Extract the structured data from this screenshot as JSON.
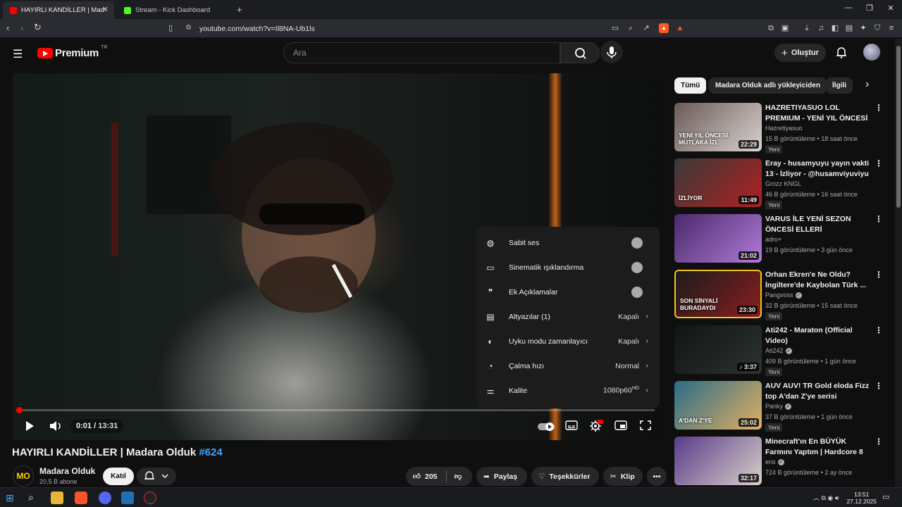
{
  "browser": {
    "tabs": [
      {
        "title": "HAYIRLI KANDİLLER | Madara Ol",
        "favicon_color": "#ff0000"
      },
      {
        "title": "Stream - Kick Dashboard",
        "favicon_color": "#53fc18"
      }
    ],
    "url": "youtube.com/watch?v=Il8NA-Ub1ls",
    "new_tab_symbol": "+"
  },
  "header": {
    "logo_text": "Premium",
    "logo_region": "TR",
    "search_placeholder": "Ara",
    "create_label": "Oluştur"
  },
  "player": {
    "current_time": "0:01",
    "duration": "13:31",
    "progress_fraction": 0.0012,
    "settings": [
      {
        "label": "Sabit ses",
        "type": "toggle",
        "icon": "stable-volume-icon"
      },
      {
        "label": "Sinematik ışıklandırma",
        "type": "toggle",
        "icon": "ambient-mode-icon"
      },
      {
        "label": "Ek Açıklamalar",
        "type": "toggle",
        "icon": "annotations-icon"
      },
      {
        "label": "Altyazılar (1)",
        "type": "value",
        "value": "Kapalı",
        "icon": "subtitles-icon"
      },
      {
        "label": "Uyku modu zamanlayıcı",
        "type": "value",
        "value": "Kapalı",
        "icon": "sleep-timer-icon"
      },
      {
        "label": "Çalma hızı",
        "type": "value",
        "value": "Normal",
        "icon": "playback-speed-icon"
      },
      {
        "label": "Kalite",
        "type": "value",
        "value": "1080p60",
        "value_sup": "HD",
        "icon": "quality-icon"
      }
    ]
  },
  "video": {
    "title": "HAYIRLI KANDİLLER | Madara Olduk",
    "hashtag": "#624",
    "channel_name": "Madara Olduk",
    "channel_logo": "MO",
    "subscribers": "20,5 B abone",
    "join_label": "Katıl",
    "likes": "205",
    "share_label": "Paylaş",
    "thanks_label": "Teşekkürler",
    "clip_label": "Klip"
  },
  "sidebar": {
    "chips": [
      "Tümü",
      "Madara Olduk adlı yükleyiciden",
      "İlgili"
    ],
    "recommendations": [
      {
        "title": "HAZRETIYASUO LOL PREMIUM - YENİ YIL ÖNCESİ HERKESİN ...",
        "channel": "Hazretiyasuo",
        "verified": false,
        "views": "15 B görüntüleme",
        "age": "18 saat önce",
        "badge": "Yeni",
        "duration": "22:29",
        "thumb_text": "YENİ YIL ÖNCESİ MUTLAKA İZL",
        "colors": [
          "#6a5a55",
          "#d9d2cf"
        ]
      },
      {
        "title": "Eray - husamyuyu yayın vakti 13 - İzliyor - @husamviyuviyu",
        "channel": "Grozz KNGL",
        "verified": false,
        "views": "46 B görüntüleme",
        "age": "16 saat önce",
        "badge": "Yeni",
        "duration": "11:49",
        "thumb_text": "İZLİYOR",
        "colors": [
          "#3a3a3a",
          "#b02020"
        ]
      },
      {
        "title": "VARUS İLE YENİ SEZON ÖNCESİ ELLERİ ISINDIRIYORUZ!",
        "channel": "adro+",
        "verified": false,
        "views": "19 B görüntüleme",
        "age": "3 gün önce",
        "badge": "",
        "duration": "21:02",
        "thumb_text": "",
        "colors": [
          "#4a2a6a",
          "#b07ad8"
        ]
      },
      {
        "title": "Orhan Ekren'e Ne Oldu? İngiltere'de Kaybolan Türk ...",
        "channel": "Pangvoss",
        "verified": true,
        "views": "32 B görüntüleme",
        "age": "15 saat önce",
        "badge": "Yeni",
        "duration": "23:30",
        "thumb_text": "SON SİNYALİ BURADAYDI",
        "colors": [
          "#1c1c1c",
          "#8a1e1e"
        ]
      },
      {
        "title": "Ati242 - Maraton (Official Video)",
        "channel": "Ati242",
        "verified": true,
        "views": "409 B görüntüleme",
        "age": "1 gün önce",
        "badge": "Yeni",
        "duration": "♪ 3:37",
        "thumb_text": "",
        "colors": [
          "#111514",
          "#2c3330"
        ]
      },
      {
        "title": "AUV AUV! TR Gold eloda Fizz top A'dan Z'ye serisi",
        "channel": "Panky",
        "verified": true,
        "views": "37 B görüntüleme",
        "age": "1 gün önce",
        "badge": "Yeni",
        "duration": "25:02",
        "thumb_text": "A'DAN Z'YE",
        "colors": [
          "#2b6b8a",
          "#e0b060"
        ]
      },
      {
        "title": "Minecraft'ın En BÜYÜK Farmını Yaptım | Hardcore 8",
        "channel": "ens",
        "verified": true,
        "views": "724 B görüntüleme",
        "age": "2 ay önce",
        "badge": "",
        "duration": "32:17",
        "thumb_text": "",
        "colors": [
          "#5a3a8a",
          "#d8d0c8"
        ]
      }
    ]
  },
  "taskbar": {
    "time": "13:51",
    "date": "27.12.2025"
  }
}
